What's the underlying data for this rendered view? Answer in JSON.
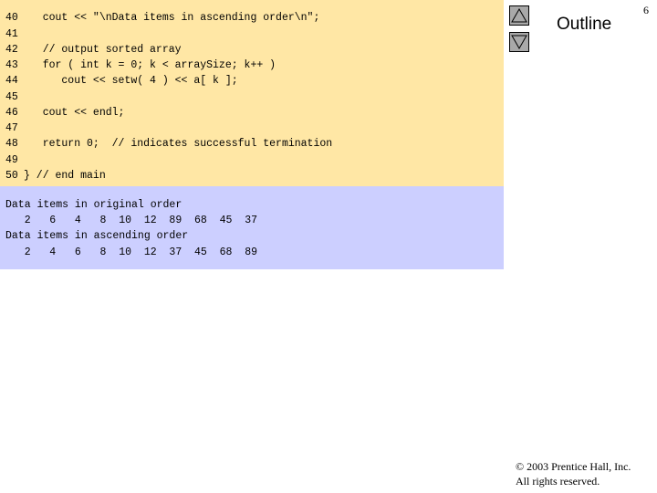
{
  "slide": {
    "page_number": "6",
    "outline_label": "Outline",
    "copyright_line1": "© 2003 Prentice Hall, Inc.",
    "copyright_line2": "All rights reserved.",
    "nav_up_icon": "triangle-up-icon",
    "nav_down_icon": "triangle-down-icon"
  },
  "code": {
    "lines": [
      {
        "n": "40",
        "t": "   cout << \"\\nData items in ascending order\\n\";"
      },
      {
        "n": "41",
        "t": ""
      },
      {
        "n": "42",
        "t": "   // output sorted array"
      },
      {
        "n": "43",
        "t": "   for ( int k = 0; k < arraySize; k++ )"
      },
      {
        "n": "44",
        "t": "      cout << setw( 4 ) << a[ k ];"
      },
      {
        "n": "45",
        "t": ""
      },
      {
        "n": "46",
        "t": "   cout << endl;"
      },
      {
        "n": "47",
        "t": ""
      },
      {
        "n": "48",
        "t": "   return 0;  // indicates successful termination"
      },
      {
        "n": "49",
        "t": ""
      },
      {
        "n": "50",
        "t": "} // end main"
      }
    ]
  },
  "output": {
    "lines": [
      "Data items in original order",
      "   2   6   4   8  10  12  89  68  45  37",
      "Data items in ascending order",
      "   2   4   6   8  10  12  37  45  68  89"
    ]
  },
  "colors": {
    "code_bg": "#ffe7a5",
    "output_bg": "#cccfff",
    "keyword": "#0000a0",
    "number": "#008000"
  }
}
